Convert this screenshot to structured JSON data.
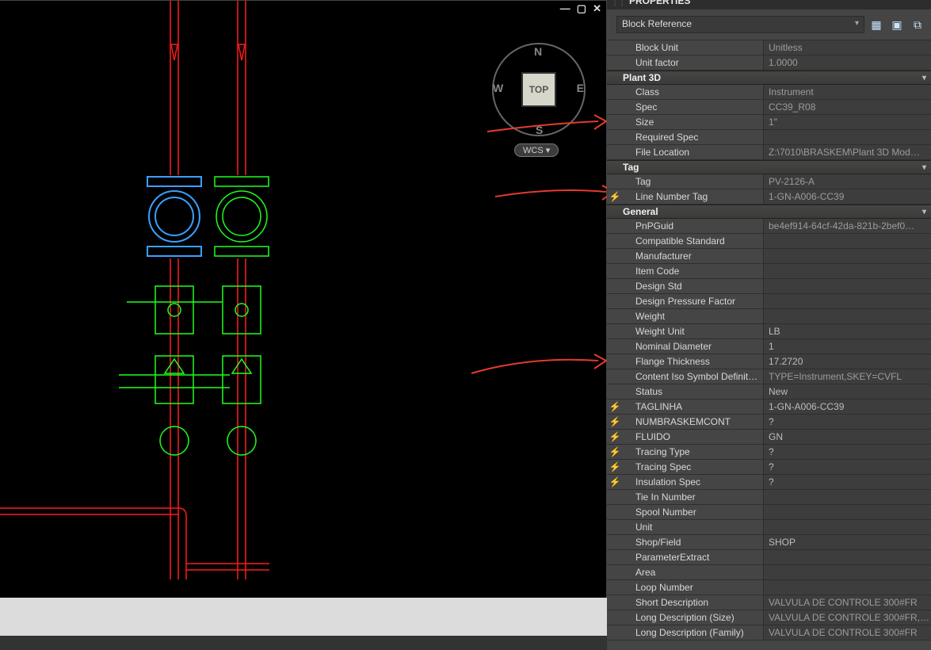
{
  "panel": {
    "title": "PROPERTIES",
    "selector": "Block Reference"
  },
  "viewport": {
    "viewcube_face": "TOP",
    "compass_n": "N",
    "compass_s": "S",
    "compass_e": "E",
    "compass_w": "W",
    "coord_label": "WCS  ▾"
  },
  "sections": {
    "misc": {
      "rows": {
        "block_unit": {
          "label": "Block Unit",
          "value": "Unitless",
          "ro": true
        },
        "unit_factor": {
          "label": "Unit factor",
          "value": "1.0000",
          "ro": true
        }
      }
    },
    "plant3d": {
      "title": "Plant 3D",
      "rows": {
        "class": {
          "label": "Class",
          "value": "Instrument",
          "ro": true
        },
        "spec": {
          "label": "Spec",
          "value": "CC39_R08",
          "ro": true
        },
        "size": {
          "label": "Size",
          "value": "1\"",
          "ro": true
        },
        "required_spec": {
          "label": "Required Spec",
          "value": ""
        },
        "file_location": {
          "label": "File Location",
          "value": "Z:\\7010\\BRASKEM\\Plant 3D Mod…",
          "ro": true
        }
      }
    },
    "tag": {
      "title": "Tag",
      "rows": {
        "tag": {
          "label": "Tag",
          "value": "PV-2126-A",
          "ro": true
        },
        "line_number_tag": {
          "label": "Line Number Tag",
          "value": "1-GN-A006-CC39",
          "ro": true,
          "bolt": true
        }
      }
    },
    "general": {
      "title": "General",
      "rows": {
        "pnpguid": {
          "label": "PnPGuid",
          "value": "be4ef914-64cf-42da-821b-2bef0…",
          "ro": true
        },
        "compat_std": {
          "label": "Compatible Standard",
          "value": ""
        },
        "manufacturer": {
          "label": "Manufacturer",
          "value": ""
        },
        "item_code": {
          "label": "Item Code",
          "value": ""
        },
        "design_std": {
          "label": "Design Std",
          "value": ""
        },
        "design_pf": {
          "label": "Design Pressure Factor",
          "value": ""
        },
        "weight": {
          "label": "Weight",
          "value": ""
        },
        "weight_unit": {
          "label": "Weight Unit",
          "value": "LB"
        },
        "nominal_diam": {
          "label": "Nominal Diameter",
          "value": "1"
        },
        "flange_thk": {
          "label": "Flange Thickness",
          "value": "17.2720"
        },
        "content_iso": {
          "label": "Content Iso Symbol Definit…",
          "value": "TYPE=Instrument,SKEY=CVFL",
          "ro": true
        },
        "status": {
          "label": "Status",
          "value": "New"
        },
        "taglinha": {
          "label": "TAGLINHA",
          "value": "1-GN-A006-CC39",
          "bolt": true
        },
        "numbraskemcont": {
          "label": "NUMBRASKEMCONT",
          "value": "?",
          "bolt": true
        },
        "fluido": {
          "label": "FLUIDO",
          "value": "GN",
          "bolt": true
        },
        "tracing_type": {
          "label": "Tracing Type",
          "value": "?",
          "bolt": true
        },
        "tracing_spec": {
          "label": "Tracing Spec",
          "value": "?",
          "bolt": true
        },
        "insulation_spec": {
          "label": "Insulation Spec",
          "value": "?",
          "bolt": true
        },
        "tie_in_number": {
          "label": "Tie In Number",
          "value": ""
        },
        "spool_number": {
          "label": "Spool Number",
          "value": ""
        },
        "unit": {
          "label": "Unit",
          "value": ""
        },
        "shop_field": {
          "label": "Shop/Field",
          "value": "SHOP"
        },
        "param_extract": {
          "label": "ParameterExtract",
          "value": ""
        },
        "area": {
          "label": "Area",
          "value": ""
        },
        "loop_number": {
          "label": "Loop Number",
          "value": ""
        },
        "short_desc": {
          "label": "Short Description",
          "value": "VALVULA DE CONTROLE 300#FR",
          "ro": true
        },
        "long_desc_size": {
          "label": "Long Description (Size)",
          "value": "VALVULA DE CONTROLE 300#FR,…",
          "ro": true
        },
        "long_desc_fam": {
          "label": "Long Description (Family)",
          "value": "VALVULA DE CONTROLE 300#FR",
          "ro": true
        }
      }
    }
  }
}
